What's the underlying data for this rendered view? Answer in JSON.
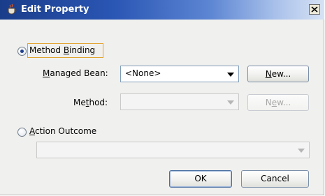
{
  "window": {
    "title": "Edit Property"
  },
  "method_binding": {
    "label_pre": "Method ",
    "label_mnemonic": "B",
    "label_post": "inding",
    "selected": true
  },
  "managed_bean": {
    "label_mnemonic": "M",
    "label_post": "anaged Bean:",
    "value": "<None>",
    "new_button": {
      "mnemonic": "N",
      "rest": "ew..."
    }
  },
  "method": {
    "label_pre": "Me",
    "label_mnemonic": "t",
    "label_post": "hod:",
    "value": "",
    "new_button": {
      "pre": "N",
      "mnemonic": "e",
      "rest": "w..."
    }
  },
  "action_outcome": {
    "label_mnemonic": "A",
    "label_post": "ction Outcome",
    "selected": false,
    "value": ""
  },
  "footer": {
    "ok_label": "OK",
    "cancel_label": "Cancel"
  },
  "colors": {
    "accent": "#2a56b4",
    "focus": "#e0a32e"
  }
}
